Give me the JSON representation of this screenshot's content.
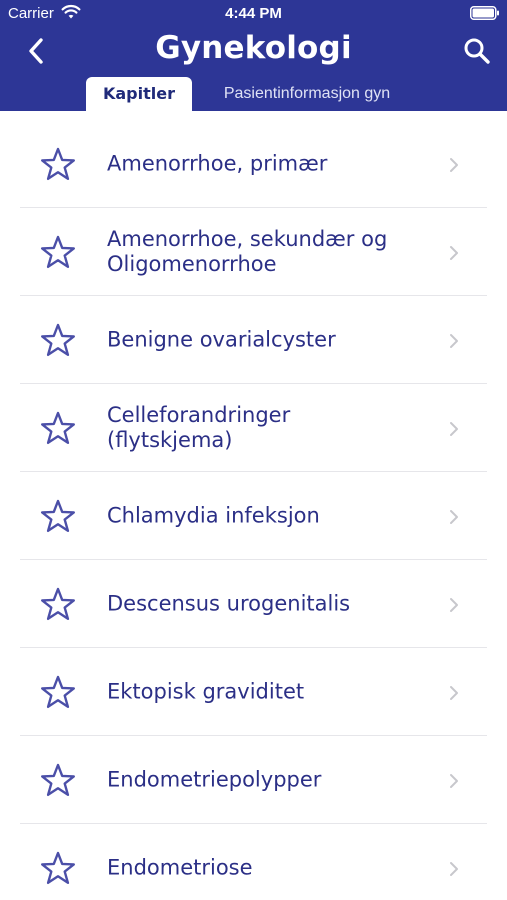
{
  "status_bar": {
    "carrier": "Carrier",
    "time": "4:44 PM"
  },
  "header": {
    "title": "Gynekologi",
    "back_icon": "chevron-left-icon",
    "search_icon": "search-icon",
    "background_color": "#2d3696"
  },
  "tabs": [
    {
      "label": "Kapitler",
      "active": true
    },
    {
      "label": "Pasientinformasjon gyn",
      "active": false
    }
  ],
  "chapters": [
    {
      "label": "Amenorrhoe, primær"
    },
    {
      "label": "Amenorrhoe, sekundær og\nOligomenorrhoe"
    },
    {
      "label": "Benigne ovarialcyster"
    },
    {
      "label": "Celleforandringer\n(flytskjema)"
    },
    {
      "label": "Chlamydia infeksjon"
    },
    {
      "label": "Descensus urogenitalis"
    },
    {
      "label": "Ektopisk graviditet"
    },
    {
      "label": "Endometriepolypper"
    },
    {
      "label": "Endometriose"
    }
  ],
  "colors": {
    "accent": "#2d3696",
    "item_text": "#2b2f86",
    "star": "#4b4fa8",
    "chevron": "#c7c7cc"
  }
}
